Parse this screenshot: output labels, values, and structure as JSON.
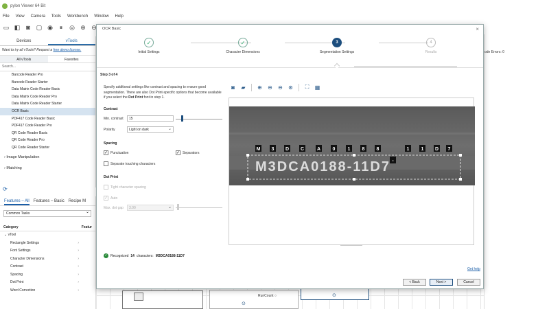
{
  "app": {
    "title": "pylon Viewer 64 Bit"
  },
  "menu": [
    "File",
    "View",
    "Camera",
    "Tools",
    "Workbench",
    "Window",
    "Help"
  ],
  "left_panel": {
    "tabs": [
      "Devices",
      "vTools"
    ],
    "try_text": "Want to try all vTools? Request a",
    "try_link": "free demo license.",
    "filters": [
      "All vTools",
      "Favorites"
    ],
    "search_placeholder": "Search...",
    "items": [
      "Barcode Reader Pro",
      "Barcode Reader Starter",
      "Data Matrix Code Reader Basic",
      "Data Matrix Code Reader Pro",
      "Data Matrix Code Reader Starter",
      "OCR Basic",
      "PDF417 Code Reader Basic",
      "PDF417 Code Reader Pro",
      "QR Code Reader Basic",
      "QR Code Reader Pro",
      "QR Code Reader Starter"
    ],
    "groups": [
      "Image Manipulation",
      "Matching"
    ]
  },
  "features": {
    "tabs": [
      "Features – All",
      "Features – Basic",
      "Recipe M"
    ],
    "dropdown": "Common Tasks",
    "cat_header": "Category",
    "feat_header": "Featur",
    "root": "vTool",
    "rows": [
      "Rectangle Settings",
      "Font Settings",
      "Character Dimensions",
      "Contrast",
      "Spacing",
      "Dot Print",
      "Word Correction"
    ]
  },
  "background": {
    "errors_label": "ode Errors: 0",
    "runcount_label": "RunCount"
  },
  "dialog": {
    "title": "OCR Basic",
    "steps": [
      {
        "label": "Initial Settings",
        "state": "done"
      },
      {
        "label": "Character Dimensions",
        "state": "done"
      },
      {
        "label": "Segmentation Settings",
        "state": "active",
        "num": "3"
      },
      {
        "label": "Results",
        "state": "future",
        "num": "4"
      }
    ],
    "step_of": "Step 3 of 4",
    "description_1": "Specify additional settings like contrast and spacing to ensure good segmentation. There are also Dot Print-specific options that become available if you select the ",
    "description_bold": "Dot Print",
    "description_2": " font in step 1.",
    "contrast": {
      "heading": "Contrast",
      "min_label": "Min. contrast",
      "min_value": "15",
      "polarity_label": "Polarity",
      "polarity_value": "Light on dark"
    },
    "spacing": {
      "heading": "Spacing",
      "punctuation": "Punctuation",
      "separators": "Separators",
      "separate_touching": "Separate touching characters"
    },
    "dot_print": {
      "heading": "Dot Print",
      "tight_spacing": "Tight character spacing",
      "auto": "Auto",
      "max_gap_label": "Max. dot gap",
      "max_gap_value": "3.00"
    },
    "recognized_chars": [
      "M",
      "3",
      "D",
      "C",
      "A",
      "0",
      "1",
      "8",
      "8",
      "-",
      "1",
      "1",
      "D",
      "7"
    ],
    "result_prefix": "Recognized",
    "result_count": "14",
    "result_mid": "characters:",
    "result_value": "M3DCA0188-11D7",
    "get_help": "Get help",
    "buttons": {
      "back": "< Back",
      "next": "Next >",
      "cancel": "Cancel"
    }
  },
  "colors": {
    "accent": "#1d4e7e",
    "success": "#2a8a3a",
    "link": "#1a5ea8"
  }
}
